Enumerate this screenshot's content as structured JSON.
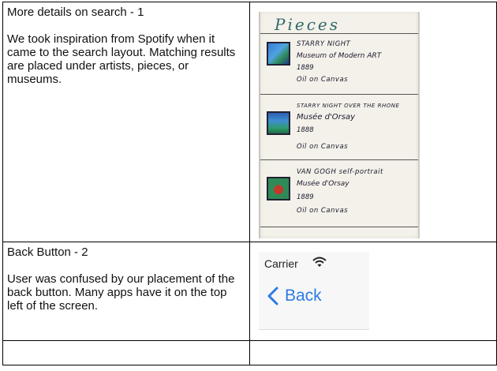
{
  "rows": [
    {
      "title": "More details on search - 1",
      "description": "We took inspiration from Spotify when it came to the search layout. Matching results are placed under artists, pieces, or museums."
    },
    {
      "title": "Back Button - 2",
      "description": "User was confused by our placement of the back button. Many apps have it on the top left of the screen."
    }
  ],
  "sketch": {
    "heading": "Pieces",
    "cards": [
      {
        "name": "STARRY NIGHT",
        "museum": "Museum of Modern ART",
        "year": "1889",
        "medium": "Oil on Canvas"
      },
      {
        "name": "STARRY NIGHT OVER THE RHONE",
        "museum": "Musée d'Orsay",
        "year": "1888",
        "medium": "Oil on Canvas"
      },
      {
        "name": "VAN GOGH self-portrait",
        "museum": "Musée d'Orsay",
        "year": "1889",
        "medium": "Oil on Canvas"
      }
    ]
  },
  "phone": {
    "carrier": "Carrier",
    "back_label": "Back",
    "accent_color": "#2c7be5"
  }
}
